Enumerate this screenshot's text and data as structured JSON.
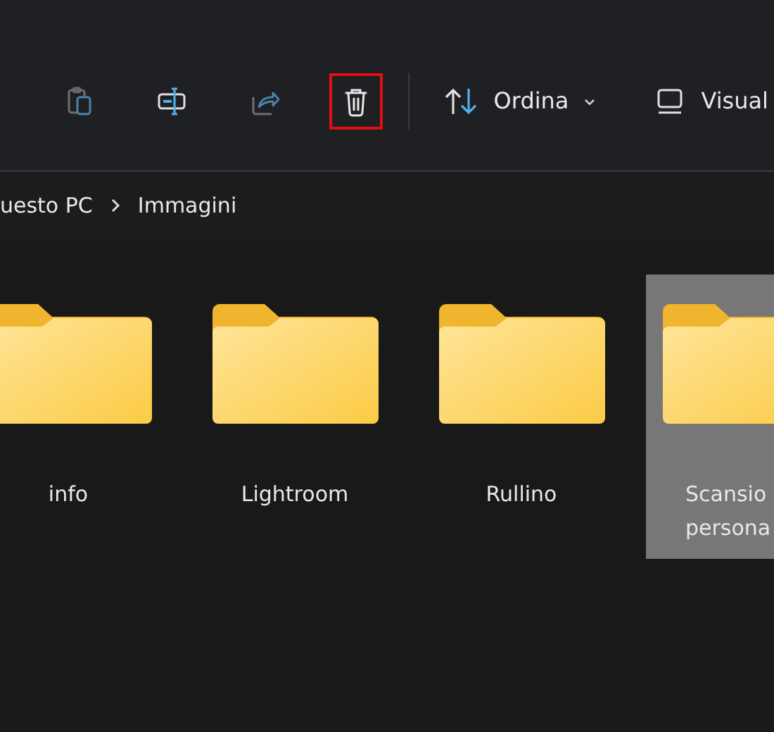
{
  "toolbar": {
    "buttons": [
      {
        "kind": "paste",
        "disabled": true,
        "highlighted": false
      },
      {
        "kind": "rename",
        "disabled": false,
        "highlighted": false
      },
      {
        "kind": "share",
        "disabled": true,
        "highlighted": false
      },
      {
        "kind": "delete",
        "disabled": false,
        "highlighted": true
      }
    ],
    "sort": {
      "label": "Ordina"
    },
    "view": {
      "label": "Visual"
    }
  },
  "breadcrumb": [
    "uesto PC",
    "Immagini"
  ],
  "folders": [
    {
      "label": "info",
      "selected": false
    },
    {
      "label": "Lightroom",
      "selected": false
    },
    {
      "label": "Rullino",
      "selected": false
    },
    {
      "label": "Scansio\npersona",
      "selected": true
    }
  ]
}
